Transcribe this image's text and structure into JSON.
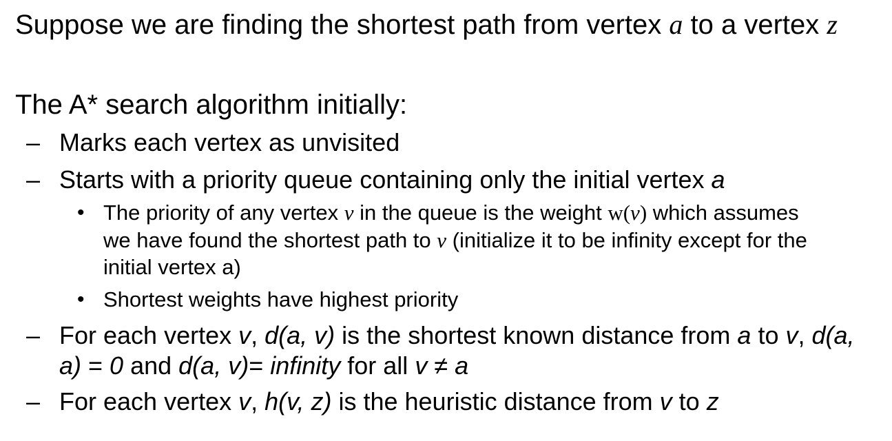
{
  "intro": {
    "text_before_a": "Suppose we are finding the shortest path from vertex ",
    "var_a": "a",
    "text_middle": " to a vertex ",
    "var_z": "z"
  },
  "heading": "The A* search algorithm initially:",
  "dash_glyph": "–",
  "bullet_glyph": "•",
  "items": {
    "marks": "Marks each vertex as unvisited",
    "starts": {
      "text": "Starts with a priority queue containing only the initial vertex ",
      "var_a": "a"
    },
    "priority": {
      "p1": "The priority of any vertex ",
      "v1": "v",
      "p2": " in the queue is the weight ",
      "w": "w(",
      "v2": "v",
      "close": ")",
      "p3": " which assumes",
      "line2a": "we have found the shortest path to ",
      "v3": "v",
      "line2b": " (initialize it to be infinity except for the",
      "line3": "initial vertex a)"
    },
    "shortest": "Shortest weights have highest priority",
    "distance": {
      "t1": "For each vertex ",
      "v1": "v",
      "t2": ", ",
      "d1": "d(a, v)",
      "t3": " is the shortest known distance from ",
      "a1": "a",
      "t4": " to ",
      "v2": "v",
      "t5": ", ",
      "d2": "d(a,",
      "line2_d": "a)",
      "line2_eq": " = ",
      "line2_zero": "0",
      "line2_and": " and ",
      "line2_d3": "d(a, v)",
      "line2_eq2": "= ",
      "line2_inf": "infinity",
      "line2_forall": " for all ",
      "line2_v": "v",
      "line2_neq": " ≠ ",
      "line2_a": "a"
    },
    "heuristic": {
      "t1": "For each vertex ",
      "v1": "v",
      "t2": ", ",
      "h": "h(v, z)",
      "t3": " is the heuristic distance from ",
      "v2": "v",
      "t4": " to ",
      "z": "z"
    }
  }
}
